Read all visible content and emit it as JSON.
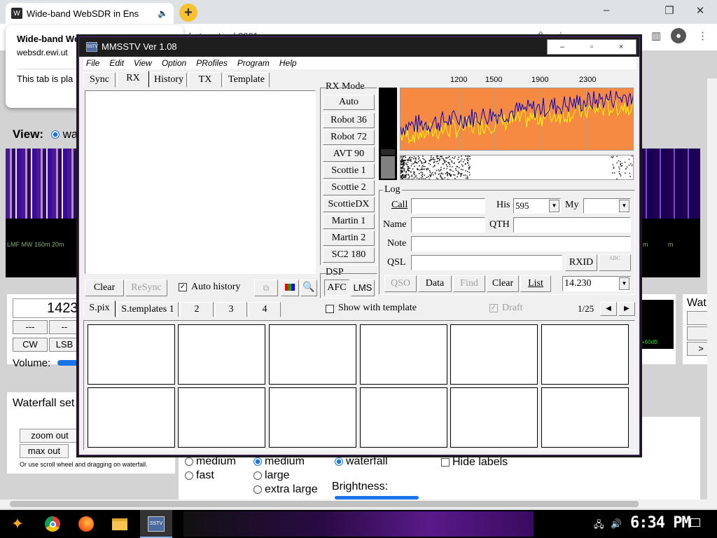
{
  "browser": {
    "tab_title": "Wide-band WebSDR in Ens",
    "tooltip_title": "Wide-band WebSDR in Enschede, th",
    "tooltip_url": "websdr.ewi.ut",
    "tooltip_note": "This tab is pla",
    "omni_partial": "la-twente.nl:8901"
  },
  "webpage": {
    "view_label": "View:",
    "view_option": "wat",
    "scale_text": "LMF  MW  160m 20m",
    "freq": "1423",
    "btn_dash1": "---",
    "btn_dash2": "--",
    "btn_cw": "CW",
    "btn_lsb": "LSB",
    "volume_label": "Volume:",
    "wf_settings": "Waterfall set",
    "zoom_out": "zoom out",
    "max_out": "max out",
    "scroll_hint": "Or use scroll wheel and dragging on waterfall.",
    "speed_medium": "medium",
    "speed_fast": "fast",
    "size_medium": "medium",
    "size_large": "large",
    "size_xlarge": "extra large",
    "view_waterfall": "waterfall",
    "brightness": "Brightness:",
    "hide_labels": "Hide labels",
    "wat_label": "Wat",
    "signal_db": "+60dB",
    "right_scale": "m"
  },
  "taskbar": {
    "clock": "6:34 PM",
    "sstv_icon": "SSTV"
  },
  "mmsstv": {
    "title": "MMSSTV Ver 1.08",
    "icon_text": "SSTV",
    "window_controls": [
      "–",
      "▫",
      "×"
    ],
    "menu": [
      "File",
      "Edit",
      "View",
      "Option",
      "PRofiles",
      "Program",
      "Help"
    ],
    "tabs": [
      "Sync",
      "RX",
      "History",
      "TX",
      "Template"
    ],
    "rx_mode_label": "RX Mode",
    "modes": [
      "Auto",
      "Robot 36",
      "Robot 72",
      "AVT 90",
      "Scottie 1",
      "Scottie 2",
      "ScottieDX",
      "Martin 1",
      "Martin 2",
      "SC2 180"
    ],
    "dsp_label": "DSP",
    "afc": "AFC",
    "lms": "LMS",
    "freq_ticks": [
      "1200",
      "1500",
      "1900",
      "2300"
    ],
    "clear": "Clear",
    "resync": "ReSync",
    "auto_history": "Auto history",
    "log": {
      "label": "Log",
      "call": "Call",
      "his": "His",
      "his_value": "595",
      "my": "My",
      "name": "Name",
      "qth": "QTH",
      "note": "Note",
      "qsl": "QSL",
      "rxid": "RXID",
      "abc": "ABC",
      "qso": "QSO",
      "data": "Data",
      "find": "Find",
      "clear": "Clear",
      "list": "List",
      "band": "14.230"
    },
    "bottom_tabs": [
      "S.pix",
      "S.templates 1",
      "2",
      "3",
      "4"
    ],
    "show_with_template": "Show with template",
    "draft": "Draft",
    "page": "1/25"
  }
}
